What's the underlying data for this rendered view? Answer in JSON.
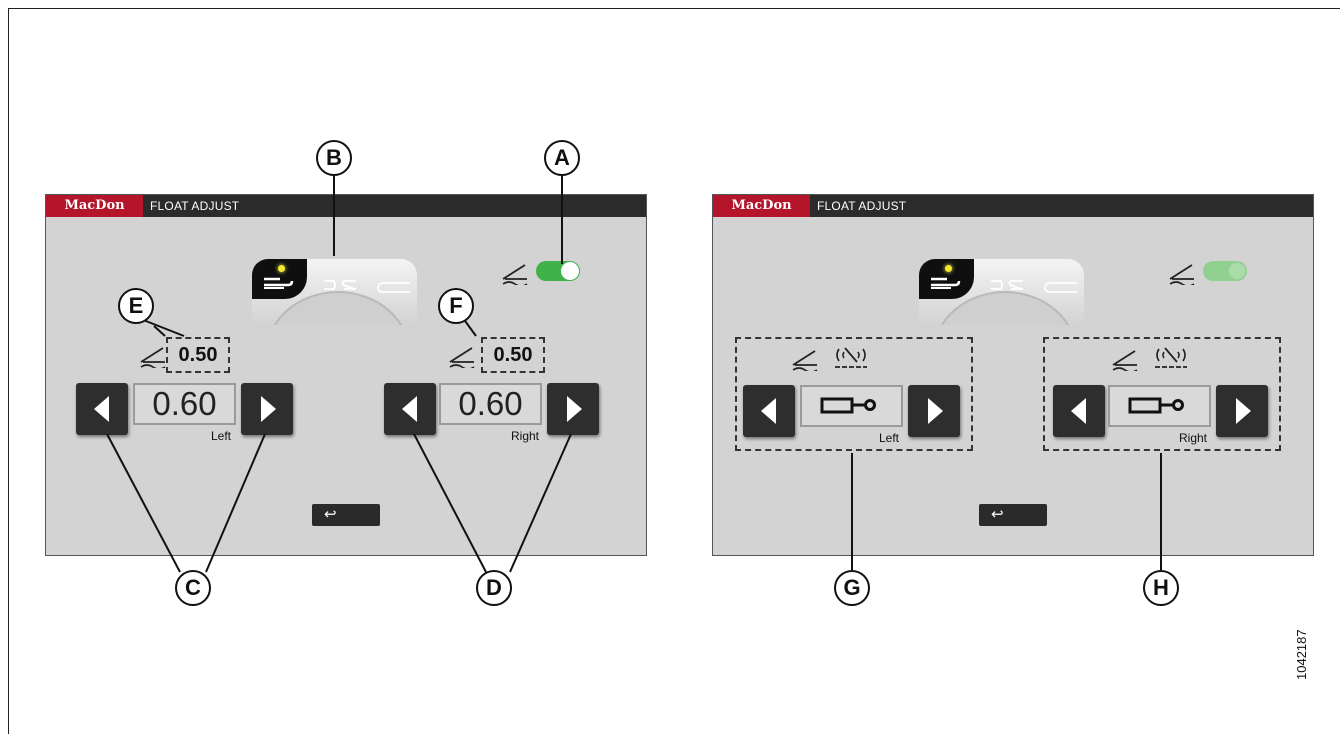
{
  "colors": {
    "brand_red": "#b5152b",
    "toggle_on": "#3fb24a",
    "toggle_faded": "#8fd08f",
    "led": "#f4ea2a"
  },
  "screens": [
    {
      "brand": "MacDon",
      "title": "FLOAT ADJUST",
      "toggle_on": true,
      "left": {
        "small_value": "0.50",
        "value": "0.60",
        "label": "Left"
      },
      "right": {
        "small_value": "0.50",
        "value": "0.60",
        "label": "Right"
      },
      "back_icon": "undo-arrow-icon"
    },
    {
      "brand": "MacDon",
      "title": "FLOAT ADJUST",
      "toggle_on": false,
      "left": {
        "label": "Left"
      },
      "right": {
        "label": "Right"
      },
      "back_icon": "undo-arrow-icon"
    }
  ],
  "callouts": [
    "A",
    "B",
    "C",
    "D",
    "E",
    "F",
    "G",
    "H"
  ],
  "figure_number": "1042187",
  "back_glyph": "↩"
}
